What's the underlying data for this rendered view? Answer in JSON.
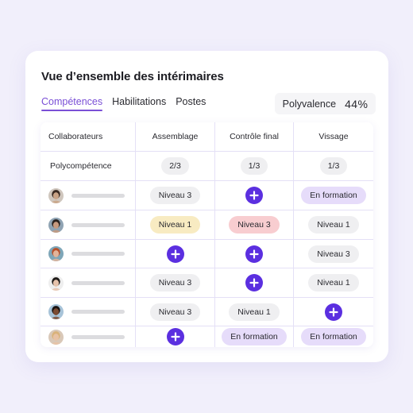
{
  "card": {
    "title": "Vue d’ensemble des intérimaires",
    "tabs": [
      {
        "label": "Compétences",
        "active": true
      },
      {
        "label": "Habilitations",
        "active": false
      },
      {
        "label": "Postes",
        "active": false
      }
    ],
    "polyvalence": {
      "label": "Polyvalence",
      "value": "44%"
    }
  },
  "colors": {
    "accent": "#7a4fd6",
    "plus_button": "#5b2fe0",
    "pill_grey": "#efeff1",
    "pill_yellow": "#f8ebc2",
    "pill_red": "#f8cdd0",
    "pill_purple": "#e6dcfa"
  },
  "table": {
    "headers": [
      "Collaborateurs",
      "Assemblage",
      "Contrôle final",
      "Vissage"
    ],
    "polycompetence": {
      "label": "Polycompétence",
      "values": [
        "2/3",
        "1/3",
        "1/3"
      ]
    },
    "rows": [
      {
        "avatar": "avatar-person-1",
        "cells": [
          {
            "type": "pill",
            "style": "grey",
            "label": "Niveau 3"
          },
          {
            "type": "add"
          },
          {
            "type": "pill",
            "style": "purple",
            "label": "En formation"
          }
        ]
      },
      {
        "avatar": "avatar-person-2",
        "cells": [
          {
            "type": "pill",
            "style": "yellow",
            "label": "Niveau 1"
          },
          {
            "type": "pill",
            "style": "red",
            "label": "Niveau 3"
          },
          {
            "type": "pill",
            "style": "grey",
            "label": "Niveau 1"
          }
        ]
      },
      {
        "avatar": "avatar-person-3",
        "cells": [
          {
            "type": "add"
          },
          {
            "type": "add"
          },
          {
            "type": "pill",
            "style": "grey",
            "label": "Niveau 3"
          }
        ]
      },
      {
        "avatar": "avatar-person-4",
        "cells": [
          {
            "type": "pill",
            "style": "grey",
            "label": "Niveau 3"
          },
          {
            "type": "add"
          },
          {
            "type": "pill",
            "style": "grey",
            "label": "Niveau 1"
          }
        ]
      },
      {
        "avatar": "avatar-person-5",
        "cells": [
          {
            "type": "pill",
            "style": "grey",
            "label": "Niveau 3"
          },
          {
            "type": "pill",
            "style": "grey",
            "label": "Niveau 1"
          },
          {
            "type": "add"
          }
        ]
      },
      {
        "avatar": "avatar-person-6",
        "cells": [
          {
            "type": "add"
          },
          {
            "type": "pill",
            "style": "purple",
            "label": "En formation"
          },
          {
            "type": "pill",
            "style": "purple",
            "label": "En formation"
          }
        ]
      }
    ]
  }
}
